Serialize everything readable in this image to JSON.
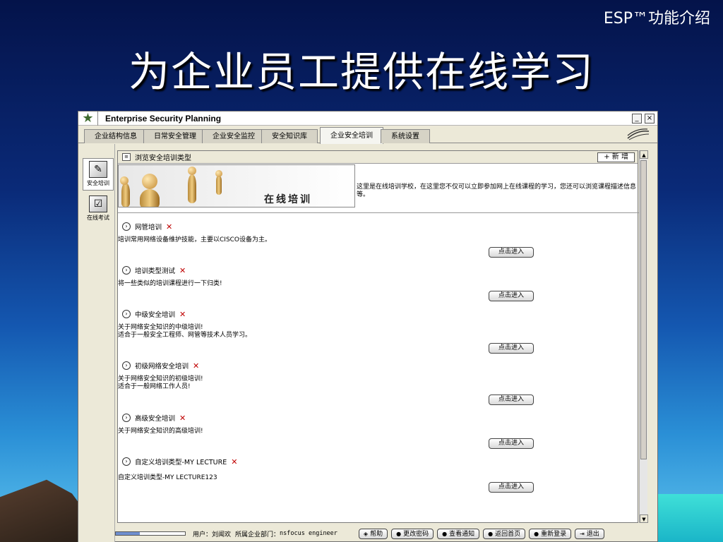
{
  "slide": {
    "corner_title": "ESP™功能介绍",
    "title": "为企业员工提供在线学习"
  },
  "app": {
    "title": "Enterprise Security Planning",
    "minimize": "_",
    "close": "×",
    "tabs": [
      {
        "label": "企业结构信息",
        "active": false
      },
      {
        "label": "日常安全管理",
        "active": false
      },
      {
        "label": "企业安全监控",
        "active": false
      },
      {
        "label": "安全知识库",
        "active": false
      },
      {
        "label": "企业安全培训",
        "active": true
      },
      {
        "label": "系统设置",
        "active": false
      }
    ],
    "sidebar": [
      {
        "label": "安全培训",
        "icon": "training-icon",
        "active": true
      },
      {
        "label": "在线考试",
        "icon": "exam-icon",
        "active": false
      }
    ]
  },
  "main": {
    "header": "浏览安全培训类型",
    "add_button": "+ 新 增",
    "banner_title": "在线培训",
    "intro": "这里是在线培训学校，在这里您不仅可以立即参加网上在线课程的学习，您还可以浏览课程描述信息等。",
    "enter_label": "点击进入",
    "courses": [
      {
        "name": "网管培训",
        "desc": [
          "培训常用网络设备维护技能，主要以CISCO设备为主。"
        ]
      },
      {
        "name": "培训类型测试",
        "desc": [
          "将一些类似的培训课程进行一下归类!"
        ]
      },
      {
        "name": "中级安全培训",
        "desc": [
          "关于网络安全知识的中级培训!",
          "适合于一般安全工程师、网管等技术人员学习。"
        ]
      },
      {
        "name": "初级网络安全培训",
        "desc": [
          "关于网络安全知识的初级培训!",
          "适合于一般网络工作人员!"
        ]
      },
      {
        "name": "高级安全培训",
        "desc": [
          "关于网络安全知识的高级培训!"
        ]
      },
      {
        "name": "自定义培训类型-MY LECTURE",
        "desc": [
          "自定义培训类型-MY  LECTURE123"
        ]
      }
    ]
  },
  "status": {
    "user_label": "用户：刘闻欢",
    "dept_label": "所属企业部门：",
    "dept_value": "nsfocus engineer",
    "buttons": [
      {
        "label": "帮助",
        "icon": "help-icon"
      },
      {
        "label": "更改密码",
        "icon": "key-icon"
      },
      {
        "label": "查看通知",
        "icon": "notice-icon"
      },
      {
        "label": "返回首页",
        "icon": "home-icon"
      },
      {
        "label": "重新登录",
        "icon": "relogin-icon"
      },
      {
        "label": "退出",
        "icon": "exit-icon"
      }
    ]
  }
}
